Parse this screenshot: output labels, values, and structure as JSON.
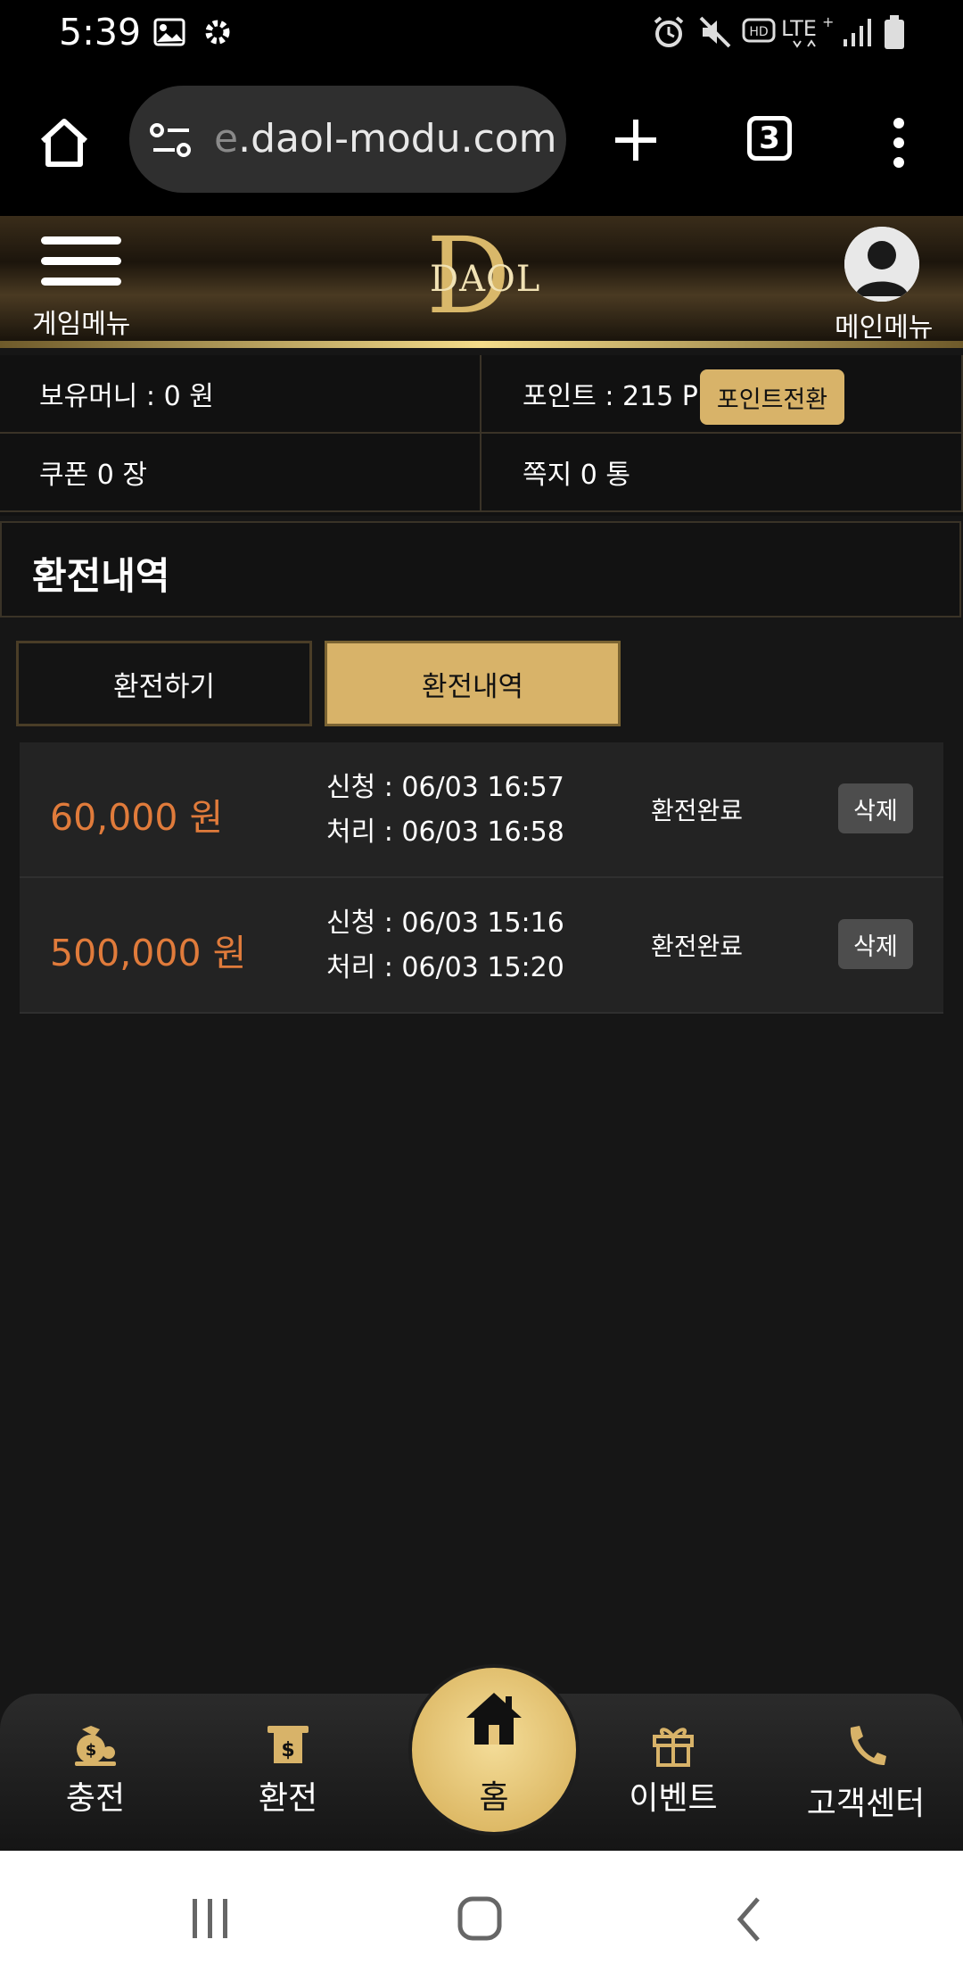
{
  "status_bar": {
    "time": "5:39"
  },
  "browser": {
    "url_faded": "e",
    "url_main": ".daol-modu.com",
    "tab_count": "3"
  },
  "header": {
    "game_menu_label": "게임메뉴",
    "logo_letter": "D",
    "logo_text": "DAOL",
    "main_menu_label": "메인메뉴"
  },
  "info": {
    "money_label": "보유머니 : 0 원",
    "point_label": "포인트 : 215 P",
    "point_convert_button": "포인트전환",
    "coupon_label": "쿠폰 0 장",
    "message_label": "쪽지 0 통"
  },
  "page": {
    "title": "환전내역"
  },
  "tabs": [
    {
      "label": "환전하기",
      "active": false
    },
    {
      "label": "환전내역",
      "active": true
    }
  ],
  "withdrawals": [
    {
      "amount": "60,000 원",
      "requested": "신청 : 06/03 16:57",
      "processed": "처리 : 06/03 16:58",
      "status": "환전완료",
      "delete_label": "삭제"
    },
    {
      "amount": "500,000 원",
      "requested": "신청 : 06/03 15:16",
      "processed": "처리 : 06/03 15:20",
      "status": "환전완료",
      "delete_label": "삭제"
    }
  ],
  "bottom_nav": {
    "charge": "충전",
    "exchange": "환전",
    "home": "홈",
    "event": "이벤트",
    "support": "고객센터"
  },
  "colors": {
    "gold": "#d8b369",
    "amount": "#e07b3b",
    "background": "#161616"
  }
}
